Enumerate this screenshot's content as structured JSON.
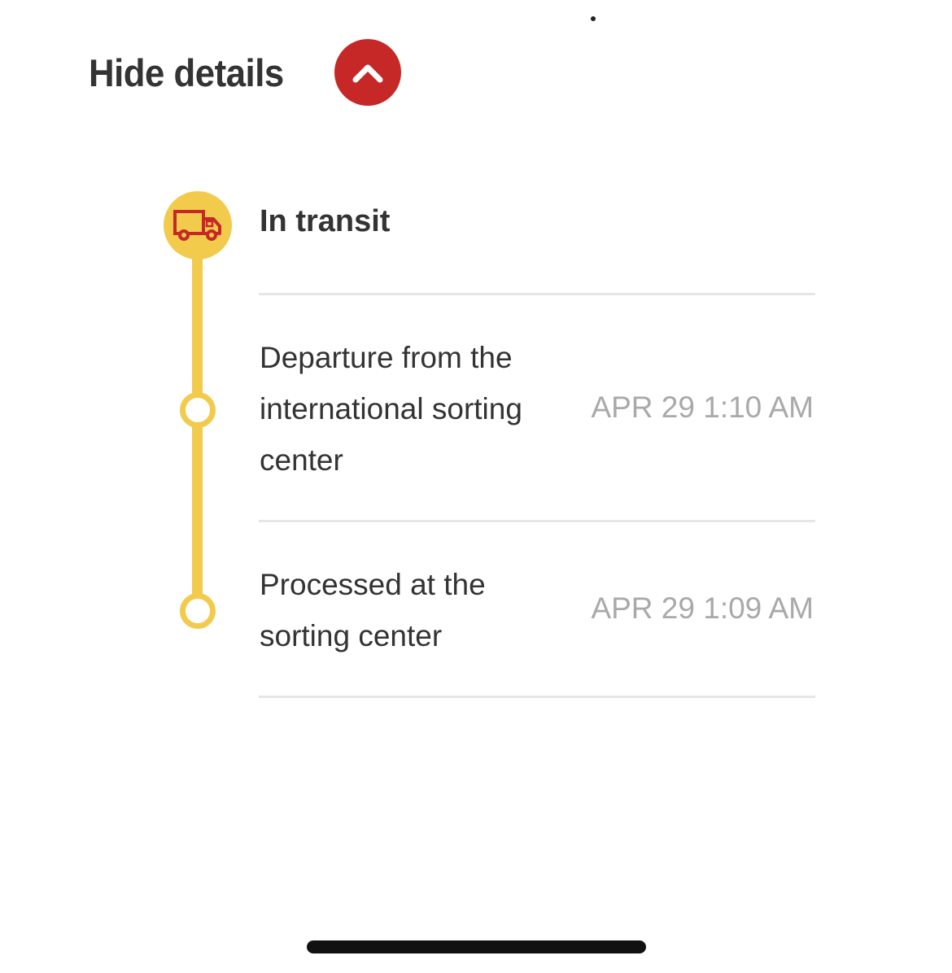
{
  "header": {
    "title": "Hide details",
    "toggle_icon": "chevron-up-icon"
  },
  "tracking": {
    "current_status": "In transit",
    "status_icon": "truck-icon",
    "events": [
      {
        "description": "Departure from the international sorting center",
        "time": "APR 29 1:10 AM"
      },
      {
        "description": "Processed at the sorting center",
        "time": "APR 29 1:09 AM"
      }
    ]
  },
  "colors": {
    "accent_red": "#c62828",
    "timeline_yellow": "#f2cb4d",
    "text_dark": "#333333",
    "text_muted": "#a9a9a9",
    "divider": "#e6e6e6"
  }
}
